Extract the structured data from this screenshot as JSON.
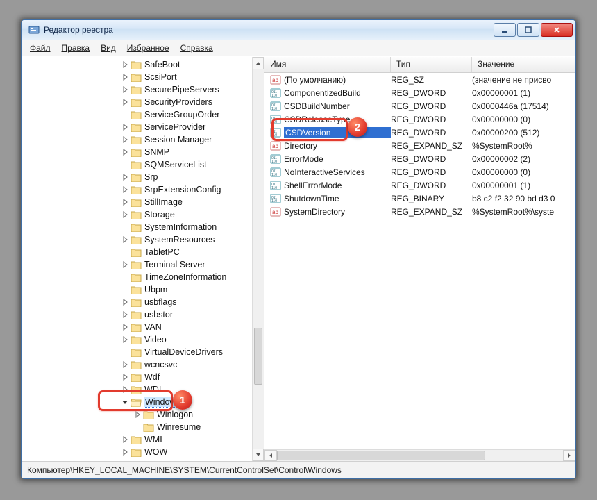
{
  "window": {
    "title": "Редактор реестра"
  },
  "menu": {
    "file": "Файл",
    "edit": "Правка",
    "view": "Вид",
    "favorites": "Избранное",
    "help": "Справка"
  },
  "tree_indent_base": 143,
  "tree_items": [
    {
      "label": "SafeBoot",
      "expander": true
    },
    {
      "label": "ScsiPort",
      "expander": true
    },
    {
      "label": "SecurePipeServers",
      "expander": true
    },
    {
      "label": "SecurityProviders",
      "expander": true
    },
    {
      "label": "ServiceGroupOrder",
      "expander": false
    },
    {
      "label": "ServiceProvider",
      "expander": true
    },
    {
      "label": "Session Manager",
      "expander": true
    },
    {
      "label": "SNMP",
      "expander": true
    },
    {
      "label": "SQMServiceList",
      "expander": false
    },
    {
      "label": "Srp",
      "expander": true
    },
    {
      "label": "SrpExtensionConfig",
      "expander": true
    },
    {
      "label": "StillImage",
      "expander": true
    },
    {
      "label": "Storage",
      "expander": true
    },
    {
      "label": "SystemInformation",
      "expander": false
    },
    {
      "label": "SystemResources",
      "expander": true
    },
    {
      "label": "TabletPC",
      "expander": false
    },
    {
      "label": "Terminal Server",
      "expander": true
    },
    {
      "label": "TimeZoneInformation",
      "expander": false
    },
    {
      "label": "Ubpm",
      "expander": false
    },
    {
      "label": "usbflags",
      "expander": true
    },
    {
      "label": "usbstor",
      "expander": true
    },
    {
      "label": "VAN",
      "expander": true
    },
    {
      "label": "Video",
      "expander": true
    },
    {
      "label": "VirtualDeviceDrivers",
      "expander": false
    },
    {
      "label": "wcncsvc",
      "expander": true
    },
    {
      "label": "Wdf",
      "expander": true
    },
    {
      "label": "WDI",
      "expander": true
    },
    {
      "label": "Windows",
      "expander": true,
      "selected": true,
      "open": true
    },
    {
      "label": "Winlogon",
      "expander": true,
      "indent": 1
    },
    {
      "label": "Winresume",
      "expander": false,
      "indent": 1
    },
    {
      "label": "WMI",
      "expander": true
    },
    {
      "label": "WOW",
      "expander": true
    }
  ],
  "columns": {
    "name": "Имя",
    "type": "Тип",
    "value": "Значение"
  },
  "values": [
    {
      "icon": "str",
      "name": "(По умолчанию)",
      "type": "REG_SZ",
      "value": "(значение не присво"
    },
    {
      "icon": "bin",
      "name": "ComponentizedBuild",
      "type": "REG_DWORD",
      "value": "0x00000001 (1)"
    },
    {
      "icon": "bin",
      "name": "CSDBuildNumber",
      "type": "REG_DWORD",
      "value": "0x0000446a (17514)"
    },
    {
      "icon": "bin",
      "name": "CSDReleaseType",
      "type": "REG_DWORD",
      "value": "0x00000000 (0)"
    },
    {
      "icon": "bin",
      "name": "CSDVersion",
      "type": "REG_DWORD",
      "value": "0x00000200 (512)",
      "selected": true
    },
    {
      "icon": "str",
      "name": "Directory",
      "type": "REG_EXPAND_SZ",
      "value": "%SystemRoot%"
    },
    {
      "icon": "bin",
      "name": "ErrorMode",
      "type": "REG_DWORD",
      "value": "0x00000002 (2)"
    },
    {
      "icon": "bin",
      "name": "NoInteractiveServices",
      "type": "REG_DWORD",
      "value": "0x00000000 (0)"
    },
    {
      "icon": "bin",
      "name": "ShellErrorMode",
      "type": "REG_DWORD",
      "value": "0x00000001 (1)"
    },
    {
      "icon": "bin",
      "name": "ShutdownTime",
      "type": "REG_BINARY",
      "value": "b8 c2 f2 32 90 bd d3 0"
    },
    {
      "icon": "str",
      "name": "SystemDirectory",
      "type": "REG_EXPAND_SZ",
      "value": "%SystemRoot%\\syste"
    }
  ],
  "status": "Компьютер\\HKEY_LOCAL_MACHINE\\SYSTEM\\CurrentControlSet\\Control\\Windows",
  "callouts": {
    "num1": "1",
    "num2": "2"
  }
}
